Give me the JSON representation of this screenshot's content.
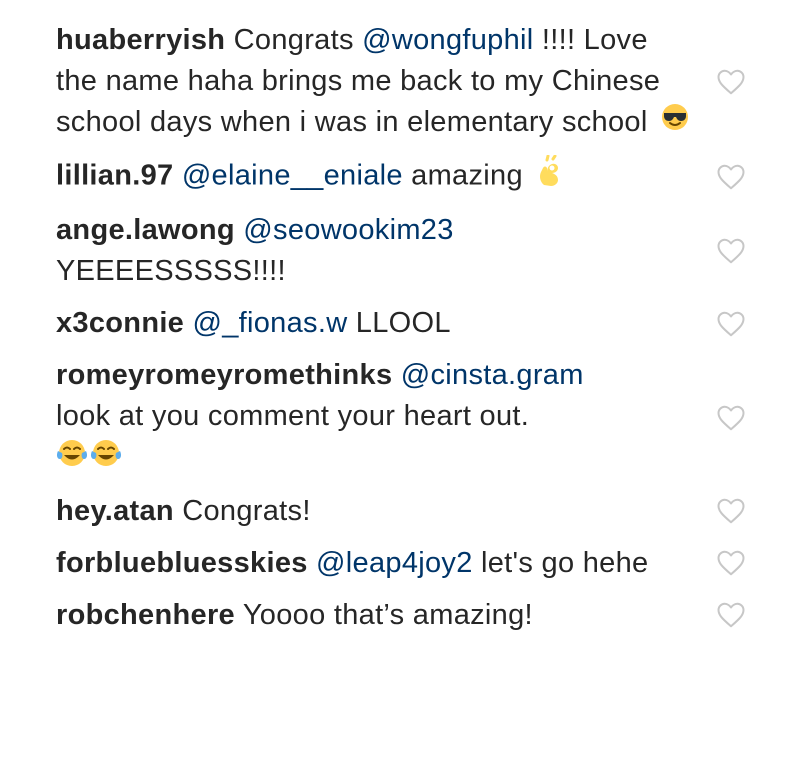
{
  "comments": [
    {
      "username": "huaberryish",
      "pre": "Congrats",
      "mention": "@wongfuphil",
      "text": "!!!! Love the name haha brings me back to my Chinese school days when i was in elementary school",
      "emojis": [
        "sunglasses-emoji"
      ]
    },
    {
      "username": "lillian.97",
      "pre": "",
      "mention": "@elaine__eniale",
      "text": "amazing",
      "emojis": [
        "ok-hand-emoji"
      ]
    },
    {
      "username": "ange.lawong",
      "pre": "",
      "mention": "@seowookim23",
      "text": "YEEEESSSSS!!!!",
      "emojis": []
    },
    {
      "username": "x3connie",
      "pre": "",
      "mention": "@_fionas.w",
      "text": "LLOOL",
      "emojis": []
    },
    {
      "username": "romeyromeyromethinks",
      "pre": "",
      "mention": "@cinsta.gram",
      "text": "look at you comment your heart out.",
      "emojis": [
        "tears-of-joy-emoji",
        "tears-of-joy-emoji"
      ]
    },
    {
      "username": "hey.atan",
      "pre": "Congrats!",
      "mention": "",
      "text": "",
      "emojis": []
    },
    {
      "username": "forbluebluesskies",
      "pre": "",
      "mention": "@leap4joy2",
      "text": "let's go hehe",
      "emojis": []
    },
    {
      "username": "robchenhere",
      "pre": "Yoooo that’s amazing!",
      "mention": "",
      "text": "",
      "emojis": []
    }
  ],
  "like_icon": "heart-outline-icon",
  "colors": {
    "text": "#262626",
    "mention": "#003569",
    "icon": "#c7c7c7"
  }
}
